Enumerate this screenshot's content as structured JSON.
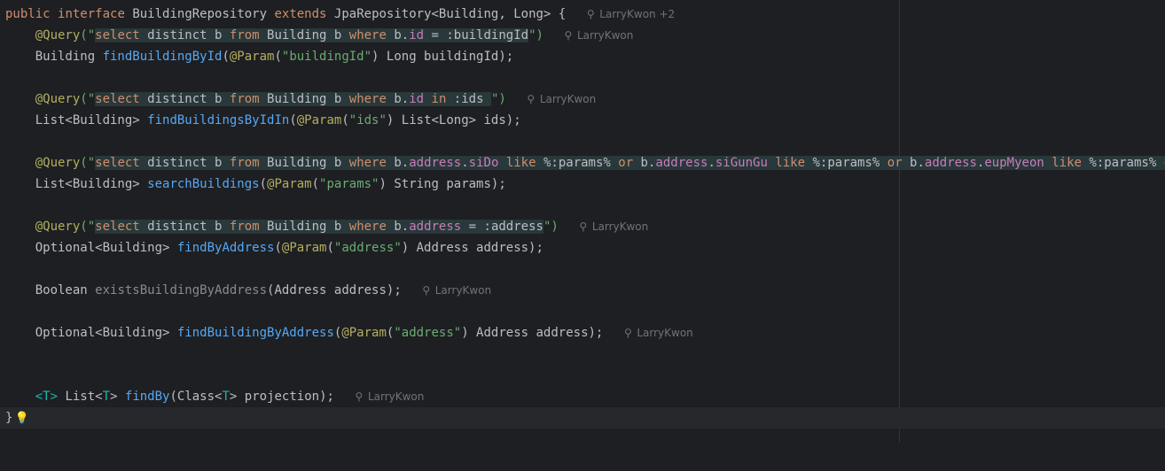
{
  "editor": {
    "l1": {
      "kw1": "public",
      "kw2": "interface",
      "name": "BuildingRepository",
      "kw3": "extends",
      "rest": "JpaRepository<Building, Long> {",
      "author": "LarryKwon +2"
    },
    "l2": {
      "ann": "@Query",
      "open": "(\"",
      "s1": "select",
      "s2": " distinct b ",
      "s3": "from",
      "s4": " Building b ",
      "s5": "where",
      "s6": " b.",
      "f1": "id",
      "s7": " = :buildingId",
      "close": "\")",
      "author": "LarryKwon"
    },
    "l3": {
      "t1": "Building ",
      "fn": "findBuildingById",
      "t2": "(",
      "ann": "@Param",
      "t3": "(",
      "str": "\"buildingId\"",
      "t4": ") Long buildingId);"
    },
    "l5": {
      "ann": "@Query",
      "open": "(\"",
      "s1": "select",
      "s2": " distinct b ",
      "s3": "from",
      "s4": " Building b ",
      "s5": "where",
      "s6": " b.",
      "f1": "id",
      "s7": " ",
      "s8": "in",
      "s9": " :ids ",
      "close": "\")",
      "author": "LarryKwon"
    },
    "l6": {
      "t1": "List<Building> ",
      "fn": "findBuildingsByIdIn",
      "t2": "(",
      "ann": "@Param",
      "t3": "(",
      "str": "\"ids\"",
      "t4": ") List<Long> ids);"
    },
    "l8": {
      "ann": "@Query",
      "open": "(\"",
      "s1": "select",
      "s2": " distinct b ",
      "s3": "from",
      "s4": " Building b ",
      "s5": "where",
      "s6": " b.",
      "f1": "address",
      "s7": ".",
      "f2": "siDo",
      "s8": " ",
      "s9": "like",
      "s10": " %:params% ",
      "s11": "or",
      "s12": " b.",
      "f3": "address",
      "s13": ".",
      "f4": "siGunGu",
      "s14": " ",
      "s15": "like",
      "s16": " %:params% ",
      "s17": "or",
      "s18": " b.",
      "f5": "address",
      "s19": ".",
      "f6": "eupMyeon",
      "s20": " ",
      "s21": "like",
      "s22": " %:params% ",
      "s23": "o"
    },
    "l9": {
      "t1": "List<Building> ",
      "fn": "searchBuildings",
      "t2": "(",
      "ann": "@Param",
      "t3": "(",
      "str": "\"params\"",
      "t4": ") String params);"
    },
    "l11": {
      "ann": "@Query",
      "open": "(\"",
      "s1": "select",
      "s2": " distinct b ",
      "s3": "from",
      "s4": " Building b ",
      "s5": "where",
      "s6": " b.",
      "f1": "address",
      "s7": " = :address",
      "close": "\")",
      "author": "LarryKwon"
    },
    "l12": {
      "t1": "Optional<Building> ",
      "fn": "findByAddress",
      "t2": "(",
      "ann": "@Param",
      "t3": "(",
      "str": "\"address\"",
      "t4": ") Address address);"
    },
    "l14": {
      "t1": "Boolean ",
      "fn": "existsBuildingByAddress",
      "t2": "(Address address);",
      "author": "LarryKwon"
    },
    "l16": {
      "t1": "Optional<Building> ",
      "fn": "findBuildingByAddress",
      "t2": "(",
      "ann": "@Param",
      "t3": "(",
      "str": "\"address\"",
      "t4": ") Address address);",
      "author": "LarryKwon"
    },
    "l19": {
      "tp1": "<T>",
      "t1": " List<",
      "tp2": "T",
      "t2": "> ",
      "fn": "findBy",
      "t3": "(Class<",
      "tp3": "T",
      "t4": "> projection);",
      "author": "LarryKwon"
    },
    "l20": {
      "brace": "}",
      "bulb_icon": "lightbulb-icon"
    }
  }
}
